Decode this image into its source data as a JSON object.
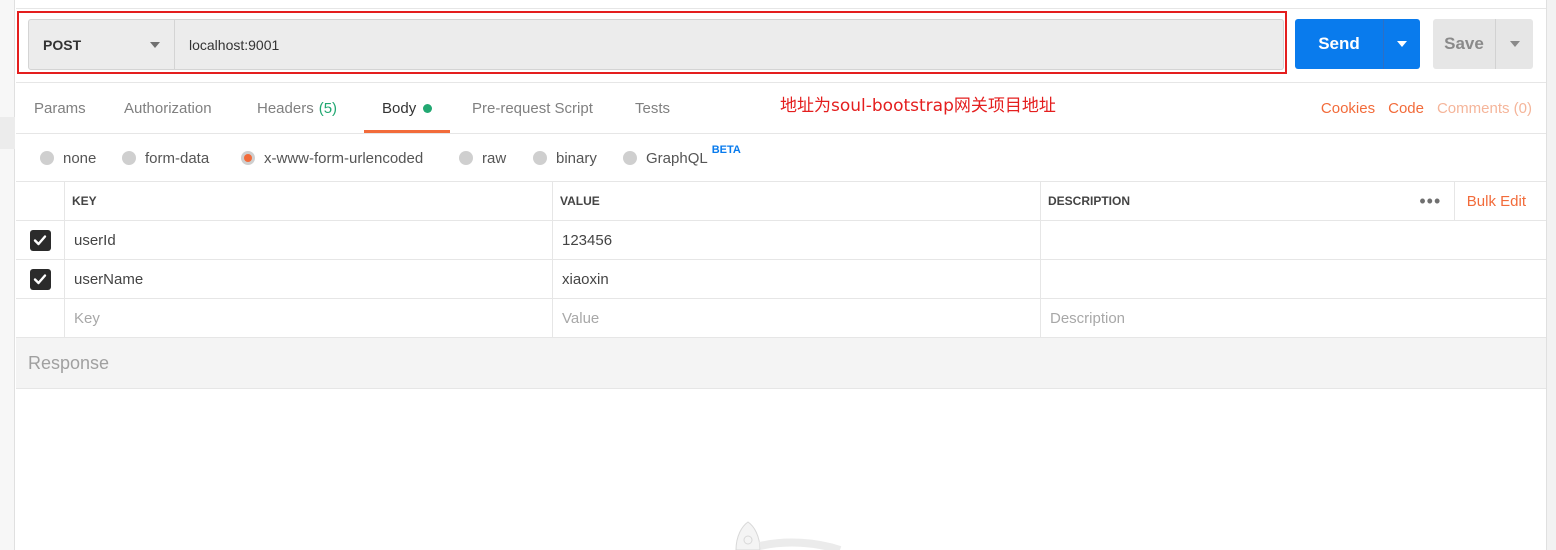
{
  "request": {
    "method": "POST",
    "url": "localhost:9001",
    "send_label": "Send",
    "save_label": "Save"
  },
  "annotation": "地址为soul-bootstrap网关项目地址",
  "tabs": [
    {
      "label": "Params"
    },
    {
      "label": "Authorization"
    },
    {
      "label": "Headers",
      "count": "(5)"
    },
    {
      "label": "Body"
    },
    {
      "label": "Pre-request Script"
    },
    {
      "label": "Tests"
    }
  ],
  "right_links": {
    "cookies": "Cookies",
    "code": "Code",
    "comments": "Comments (0)"
  },
  "body_types": [
    {
      "label": "none"
    },
    {
      "label": "form-data"
    },
    {
      "label": "x-www-form-urlencoded",
      "selected": true
    },
    {
      "label": "raw"
    },
    {
      "label": "binary"
    },
    {
      "label": "GraphQL",
      "badge": "BETA"
    }
  ],
  "table": {
    "headers": {
      "key": "KEY",
      "value": "VALUE",
      "description": "DESCRIPTION"
    },
    "bulk_edit": "Bulk Edit",
    "rows": [
      {
        "key": "userId",
        "value": "123456",
        "description": "",
        "checked": true
      },
      {
        "key": "userName",
        "value": "xiaoxin",
        "description": "",
        "checked": true
      }
    ],
    "placeholders": {
      "key": "Key",
      "value": "Value",
      "description": "Description"
    }
  },
  "response": {
    "title": "Response"
  },
  "colors": {
    "accent_orange": "#f26b3a",
    "send_blue": "#097bed",
    "annotation_red": "#e41e1e",
    "count_green": "#22a872"
  }
}
